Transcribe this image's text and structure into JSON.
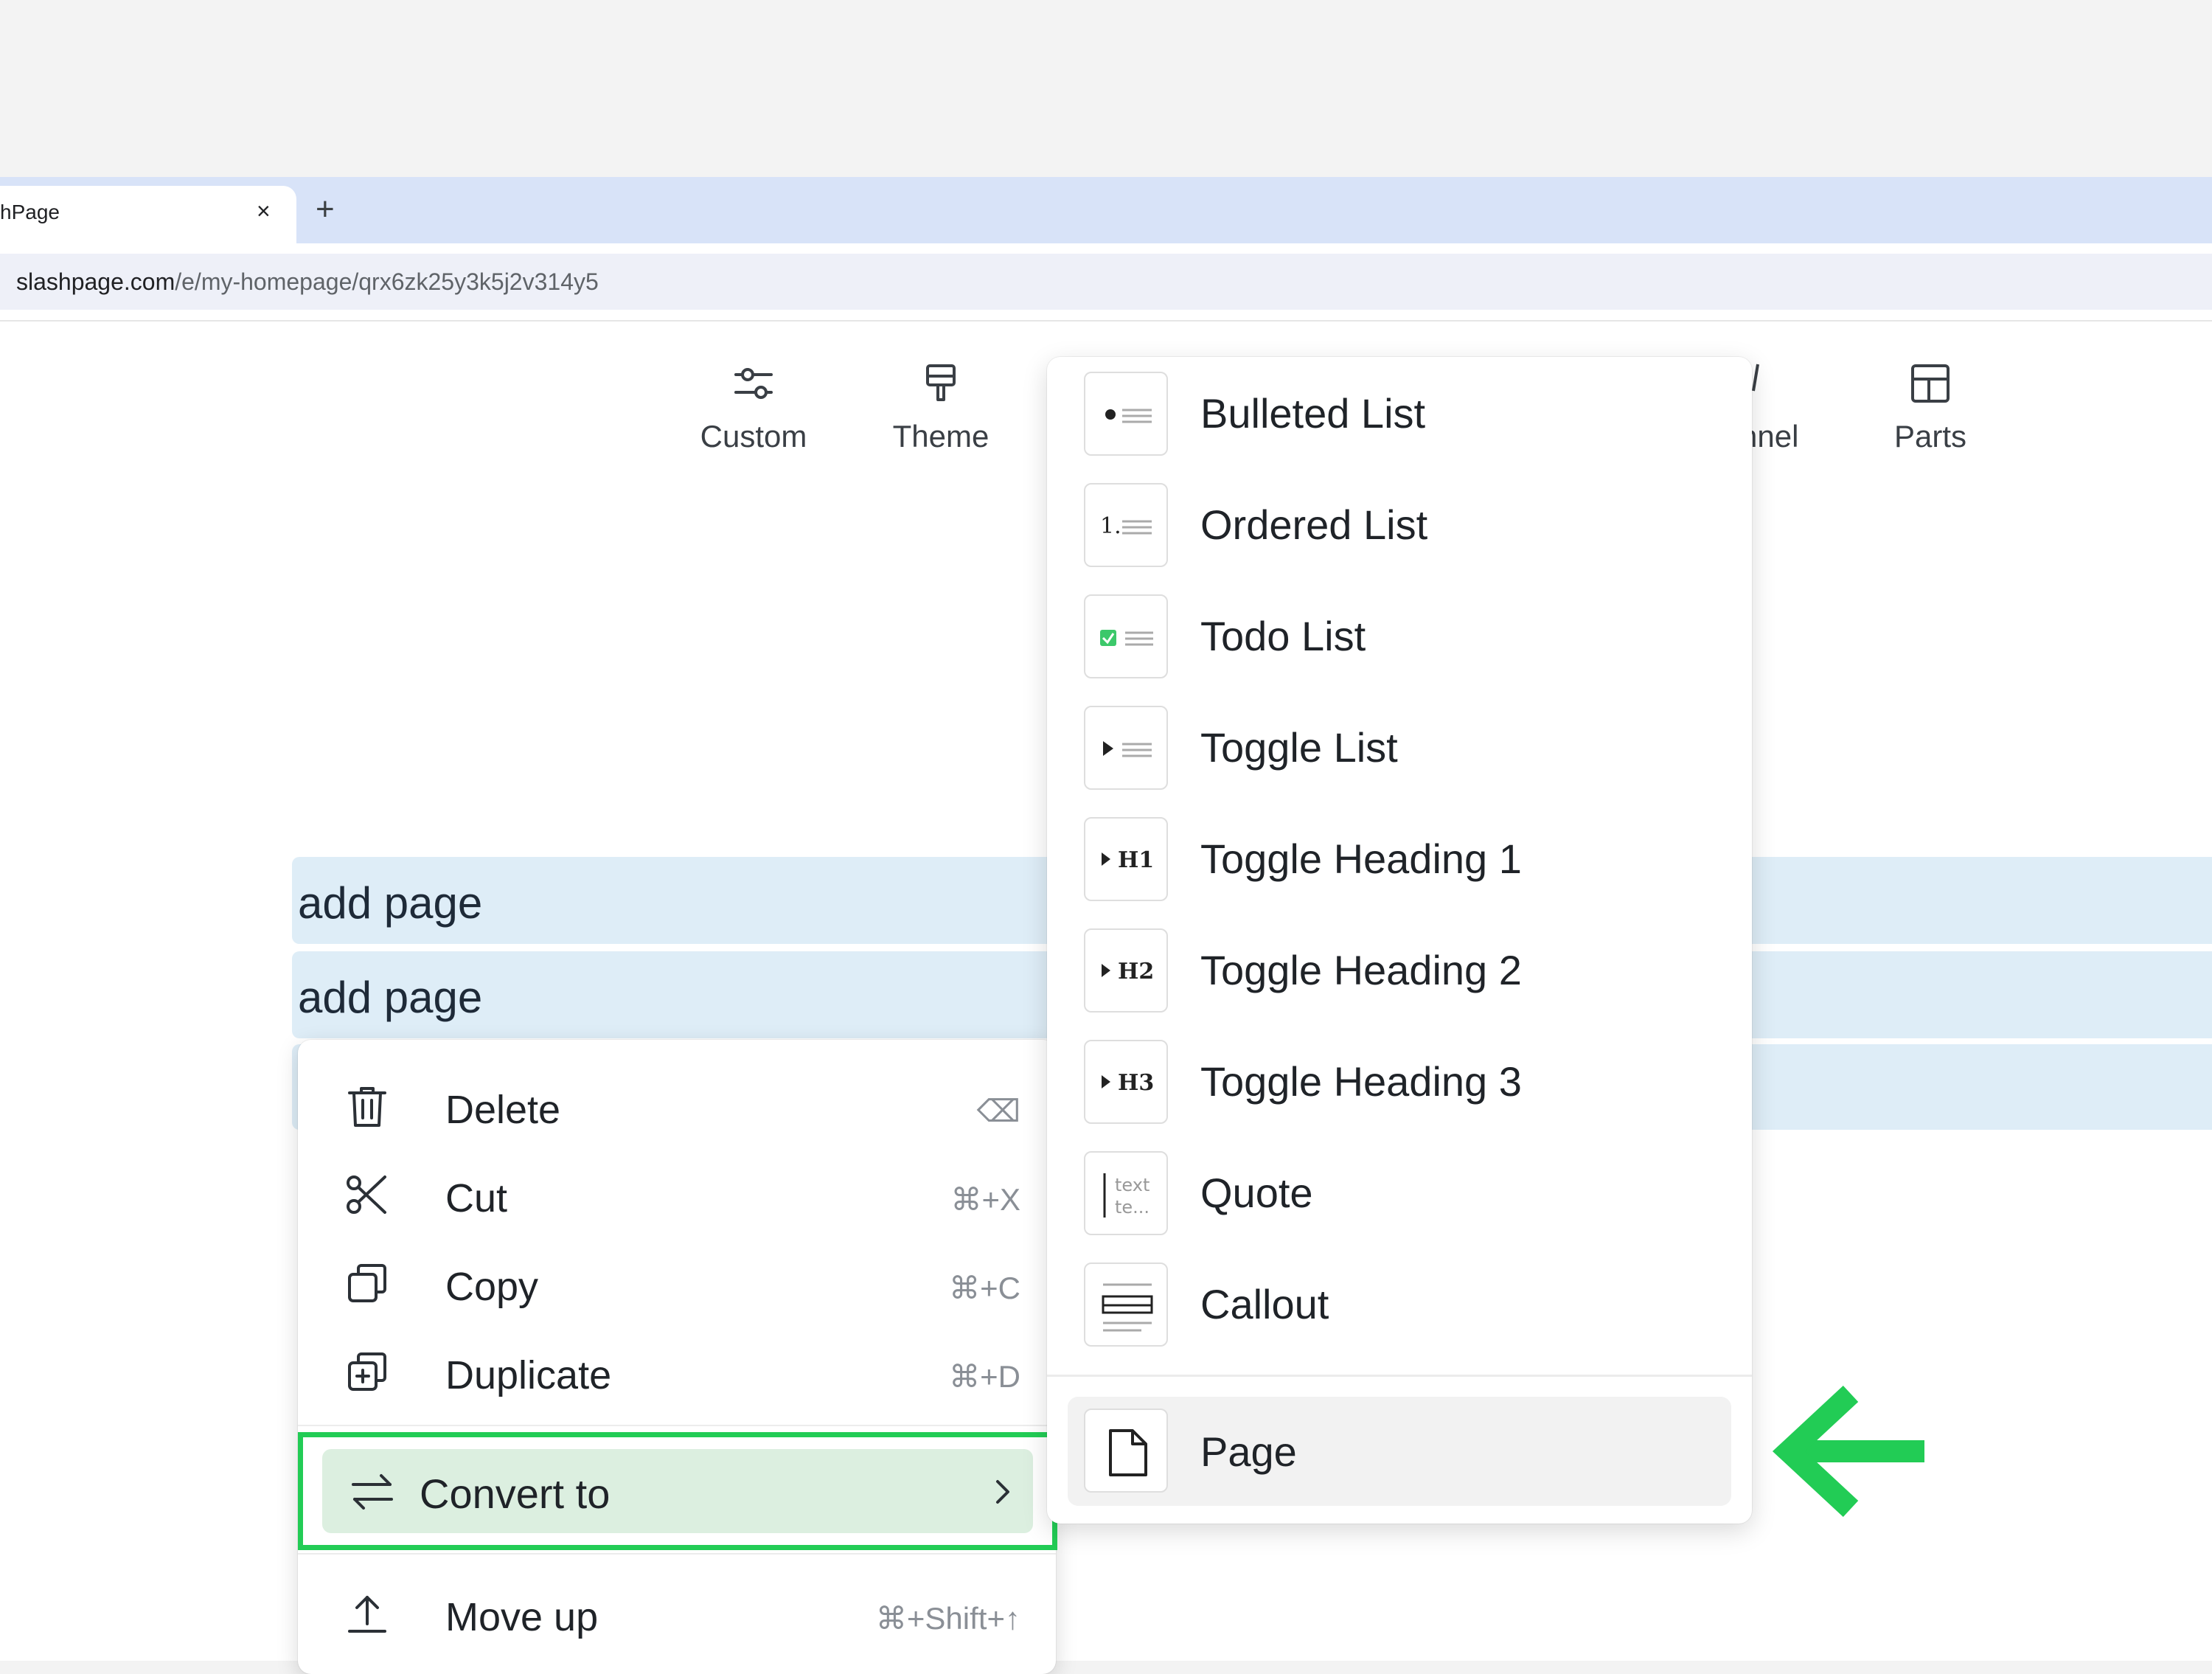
{
  "browser": {
    "tab_title": "hPage",
    "tab_close": "×",
    "new_tab": "+",
    "url_domain": "slashpage.com",
    "url_path": "/e/my-homepage/qrx6zk25y3k5j2v314y5"
  },
  "toolbar": {
    "custom": "Custom",
    "theme": "Theme",
    "channel_partial": "nnel",
    "parts": "Parts"
  },
  "rows": [
    "add page",
    "add page"
  ],
  "context_menu": {
    "items": [
      {
        "label": "Delete",
        "shortcut": "⌫",
        "icon": "trash-icon"
      },
      {
        "label": "Cut",
        "shortcut": "⌘+X",
        "icon": "scissors-icon"
      },
      {
        "label": "Copy",
        "shortcut": "⌘+C",
        "icon": "copy-icon"
      },
      {
        "label": "Duplicate",
        "shortcut": "⌘+D",
        "icon": "duplicate-icon"
      }
    ],
    "convert": {
      "label": "Convert to",
      "icon": "convert-arrows-icon"
    },
    "move_up": {
      "label": "Move up",
      "shortcut": "⌘+Shift+↑",
      "icon": "arrow-up-icon"
    }
  },
  "submenu": {
    "items": [
      {
        "label": "Bulleted List",
        "icon": "bulleted-list-icon"
      },
      {
        "label": "Ordered List",
        "icon": "ordered-list-icon",
        "thumb_text": "1."
      },
      {
        "label": "Todo List",
        "icon": "todo-list-icon"
      },
      {
        "label": "Toggle List",
        "icon": "toggle-list-icon"
      },
      {
        "label": "Toggle Heading 1",
        "icon": "toggle-h1-icon",
        "thumb_text": "H1"
      },
      {
        "label": "Toggle Heading 2",
        "icon": "toggle-h2-icon",
        "thumb_text": "H2"
      },
      {
        "label": "Toggle Heading 3",
        "icon": "toggle-h3-icon",
        "thumb_text": "H3"
      },
      {
        "label": "Quote",
        "icon": "quote-icon",
        "thumb_text": "text",
        "thumb_text2": "te..."
      },
      {
        "label": "Callout",
        "icon": "callout-icon"
      }
    ],
    "page": {
      "label": "Page",
      "icon": "page-icon"
    }
  },
  "colors": {
    "highlight_green": "#22cc55",
    "row_blue": "#deedf7",
    "tab_strip": "#d8e3f8",
    "todo_check": "#3cc86a"
  }
}
